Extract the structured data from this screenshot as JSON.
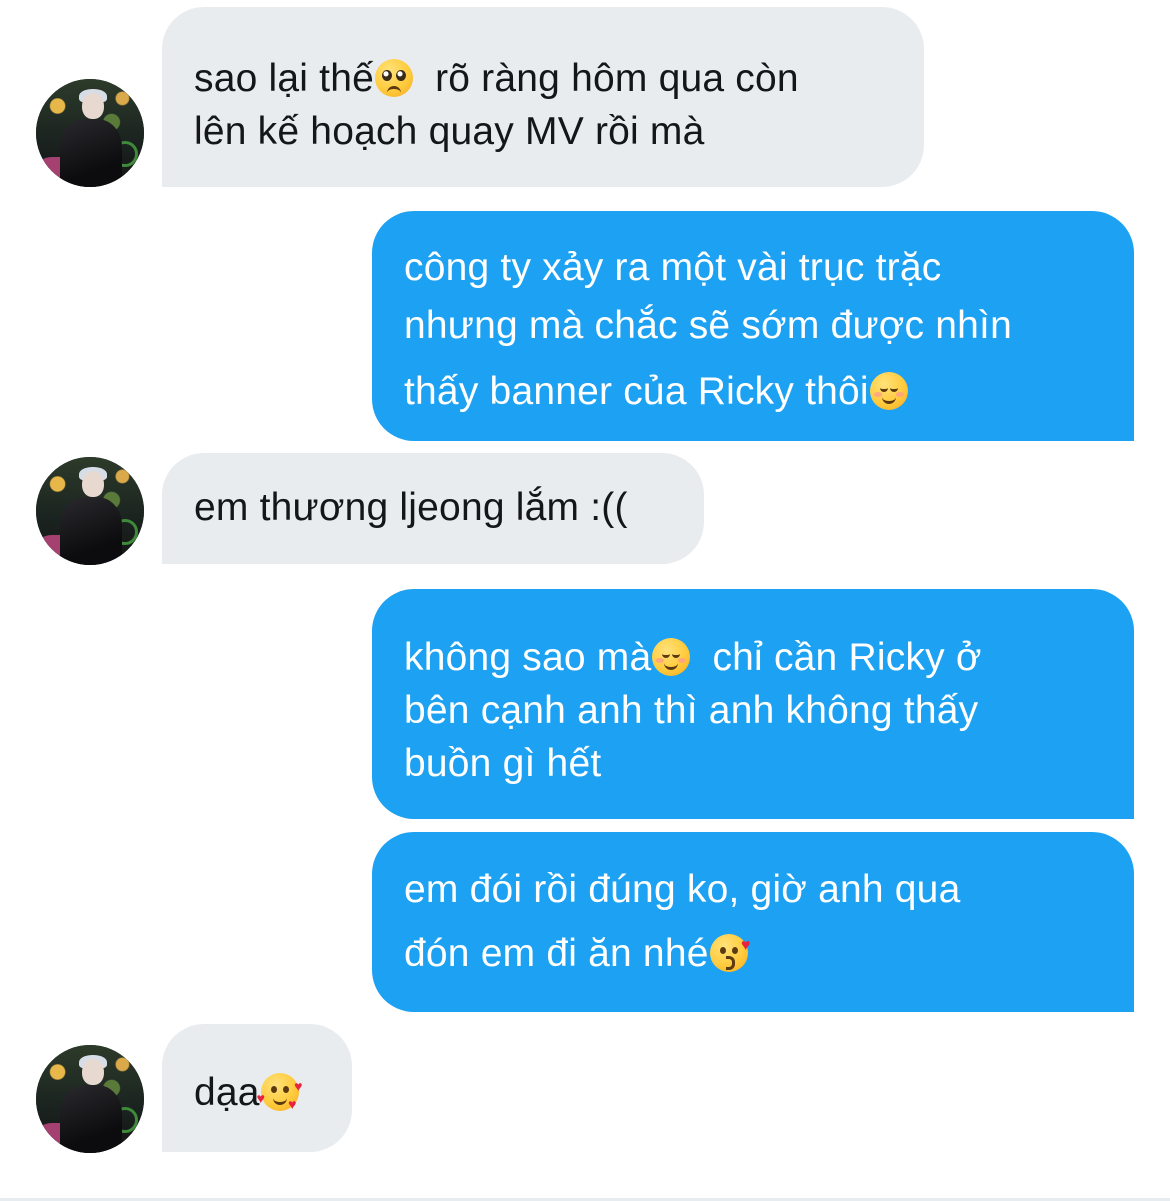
{
  "conversation": {
    "messages": [
      {
        "direction": "incoming",
        "lines": [
          "sao lại thế",
          "  rõ ràng hôm qua còn",
          "lên kế hoạch quay MV rồi mà"
        ],
        "emojis": [
          "pleading-face-emoji"
        ]
      },
      {
        "direction": "outgoing",
        "lines": [
          "công ty xảy ra một vài trục trặc",
          "nhưng mà chắc sẽ sớm được nhìn",
          "thấy banner của Ricky thôi"
        ],
        "emojis": [
          "smiling-face-emoji"
        ]
      },
      {
        "direction": "incoming",
        "lines": [
          "em thương ljeong lắm :(("
        ]
      },
      {
        "direction": "outgoing",
        "lines": [
          "không sao mà",
          "  chỉ cần Ricky ở",
          "bên cạnh anh thì anh không thấy",
          "buồn gì hết"
        ],
        "emojis": [
          "smiling-face-emoji"
        ]
      },
      {
        "direction": "outgoing",
        "lines": [
          "em đói rồi đúng ko, giờ anh qua",
          "đón em đi ăn nhé"
        ],
        "emojis": [
          "face-blowing-kiss-emoji"
        ]
      },
      {
        "direction": "incoming",
        "lines": [
          "dạa"
        ],
        "emojis": [
          "smiling-face-with-hearts-emoji"
        ]
      }
    ]
  },
  "colors": {
    "outgoing_bubble": "#1da1f2",
    "incoming_bubble": "#e9ecef",
    "incoming_text": "#14171a",
    "outgoing_text": "#ffffff"
  }
}
